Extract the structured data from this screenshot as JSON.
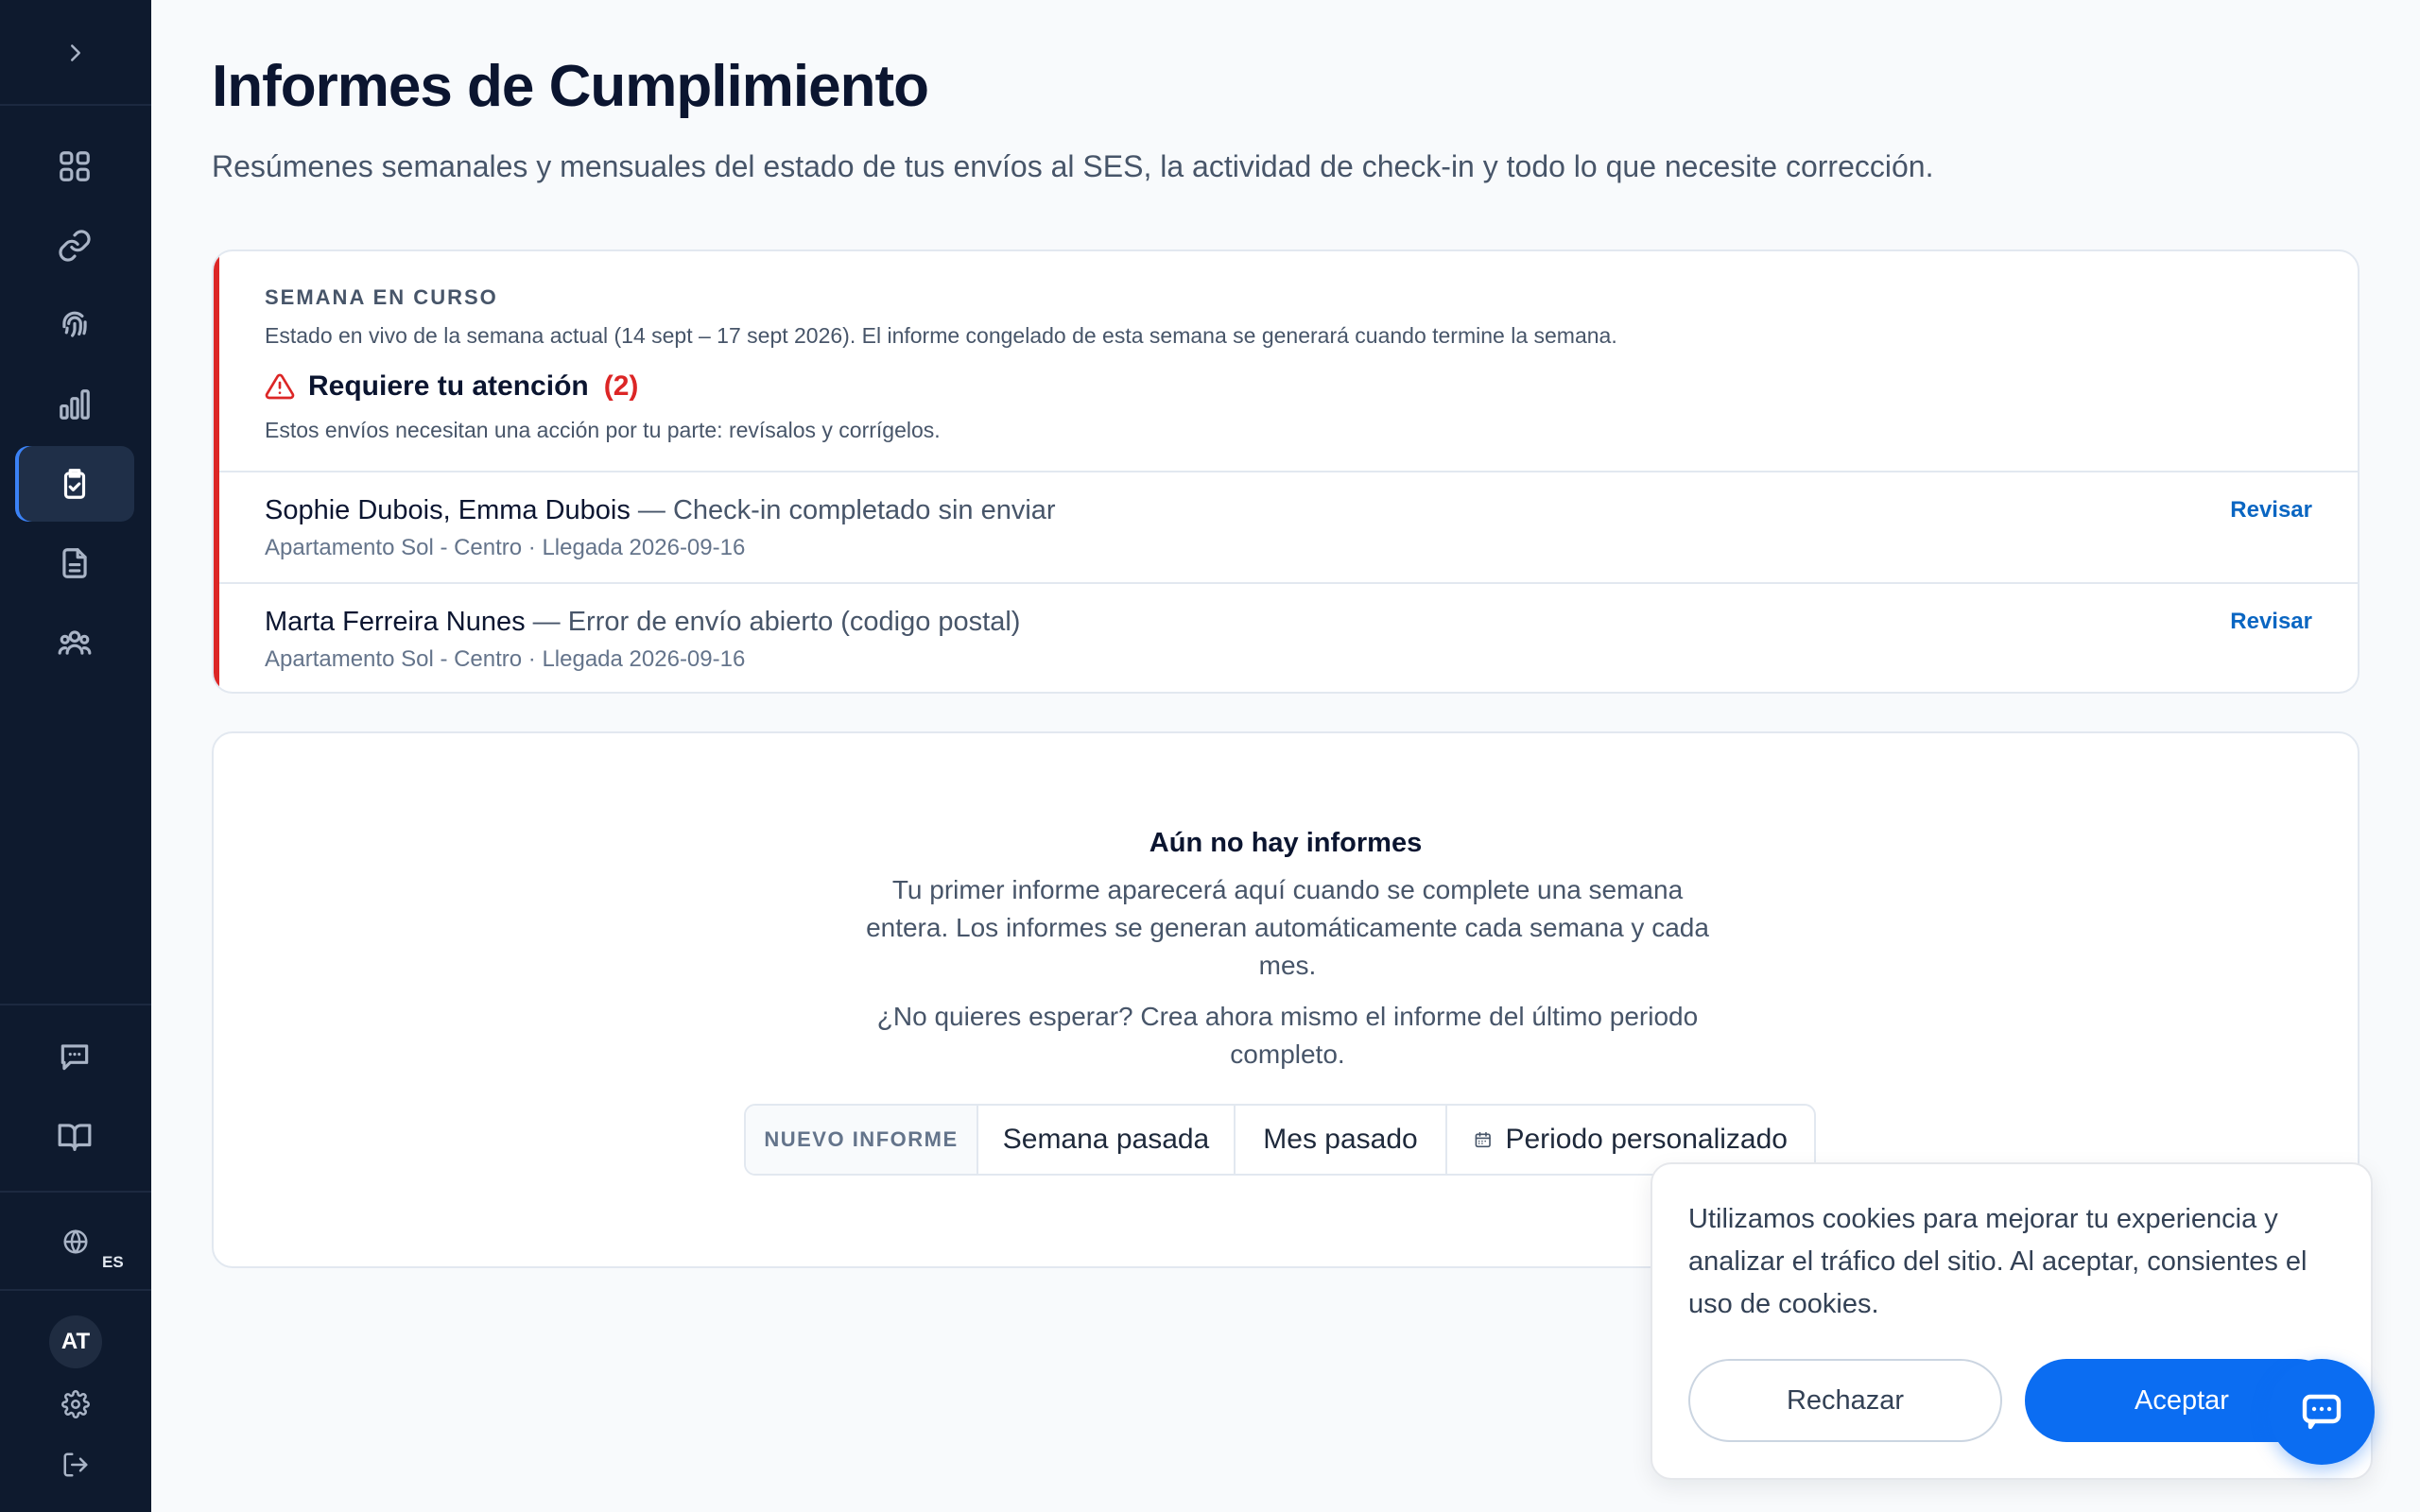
{
  "sidebar": {
    "items": [
      {
        "icon": "grid-icon"
      },
      {
        "icon": "link-icon"
      },
      {
        "icon": "fingerprint-icon"
      },
      {
        "icon": "bar-chart-icon"
      },
      {
        "icon": "clipboard-check-icon",
        "active": true
      },
      {
        "icon": "document-icon"
      },
      {
        "icon": "users-icon"
      }
    ],
    "bottom_items": [
      {
        "icon": "chat-icon"
      },
      {
        "icon": "book-icon"
      }
    ],
    "language_code": "ES",
    "avatar_initials": "AT"
  },
  "page": {
    "title": "Informes de Cumplimiento",
    "subtitle": "Resúmenes semanales y mensuales del estado de tus envíos al SES, la actividad de check-in y todo lo que necesite corrección."
  },
  "current_week": {
    "eyebrow": "SEMANA EN CURSO",
    "description": "Estado en vivo de la semana actual (14 sept – 17 sept 2026). El informe congelado de esta semana se generará cuando termine la semana.",
    "attention_title": "Requiere tu atención",
    "attention_count": "(2)",
    "attention_description": "Estos envíos necesitan una acción por tu parte: revísalos y corrígelos.",
    "items": [
      {
        "names": "Sophie Dubois, Emma Dubois",
        "issue": " — Check-in completado sin enviar",
        "details": "Apartamento Sol - Centro · Llegada 2026-09-16",
        "action": "Revisar"
      },
      {
        "names": "Marta Ferreira Nunes",
        "issue": " — Error de envío abierto (codigo postal)",
        "details": "Apartamento Sol - Centro · Llegada 2026-09-16",
        "action": "Revisar"
      }
    ]
  },
  "empty_state": {
    "title": "Aún no hay informes",
    "description": "Tu primer informe aparecerá aquí cuando se complete una semana entera. Los informes se generan automáticamente cada semana y cada mes.",
    "prompt": "¿No quieres esperar? Crea ahora mismo el informe del último periodo completo.",
    "new_report_label": "NUEVO INFORME",
    "options": [
      "Semana pasada",
      "Mes pasado",
      "Periodo personalizado"
    ]
  },
  "cookie_banner": {
    "text": "Utilizamos cookies para mejorar tu experiencia y analizar el tráfico del sitio. Al aceptar, consientes el uso de cookies.",
    "reject_label": "Rechazar",
    "accept_label": "Aceptar"
  },
  "colors": {
    "sidebar_bg": "#0e1a2e",
    "accent": "#0b6df2",
    "alert": "#dc2626",
    "link": "#0a66c2"
  }
}
